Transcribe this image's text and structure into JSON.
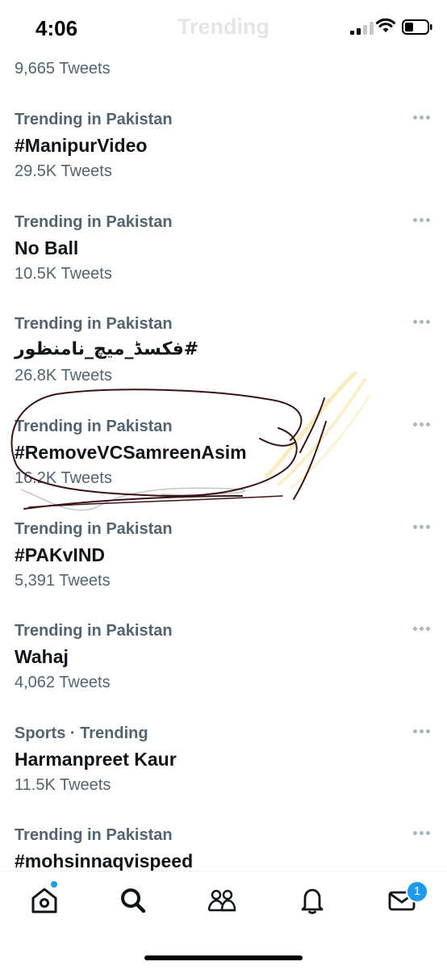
{
  "status_bar": {
    "time": "4:06",
    "faded_title": "Trending"
  },
  "partial_trend": {
    "count": "9,665 Tweets"
  },
  "trends": [
    {
      "context": "Trending in Pakistan",
      "name": "#ManipurVideo",
      "count": "29.5K Tweets"
    },
    {
      "context": "Trending in Pakistan",
      "name": "No Ball",
      "count": "10.5K Tweets"
    },
    {
      "context": "Trending in Pakistan",
      "name": "#فکسڈ_میچ_نامنظور",
      "count": "26.8K Tweets"
    },
    {
      "context": "Trending in Pakistan",
      "name": "#RemoveVCSamreenAsim",
      "count": "16.2K Tweets"
    },
    {
      "context": "Trending in Pakistan",
      "name": "#PAKvIND",
      "count": "5,391 Tweets"
    },
    {
      "context": "Trending in Pakistan",
      "name": "Wahaj",
      "count": "4,062 Tweets"
    },
    {
      "context": "Sports · Trending",
      "name": "Harmanpreet Kaur",
      "count": "11.5K Tweets"
    },
    {
      "context": "Trending in Pakistan",
      "name": "#mohsinnaqvispeed",
      "count": ""
    }
  ],
  "tab_bar": {
    "icons": [
      "home-icon",
      "search-icon",
      "communities-icon",
      "notifications-icon",
      "messages-icon"
    ],
    "messages_badge": "1"
  },
  "colors": {
    "accent": "#1d9bf0",
    "secondary_text": "#536471",
    "primary_text": "#0f1419",
    "annotation_ink": "#3a1414"
  }
}
